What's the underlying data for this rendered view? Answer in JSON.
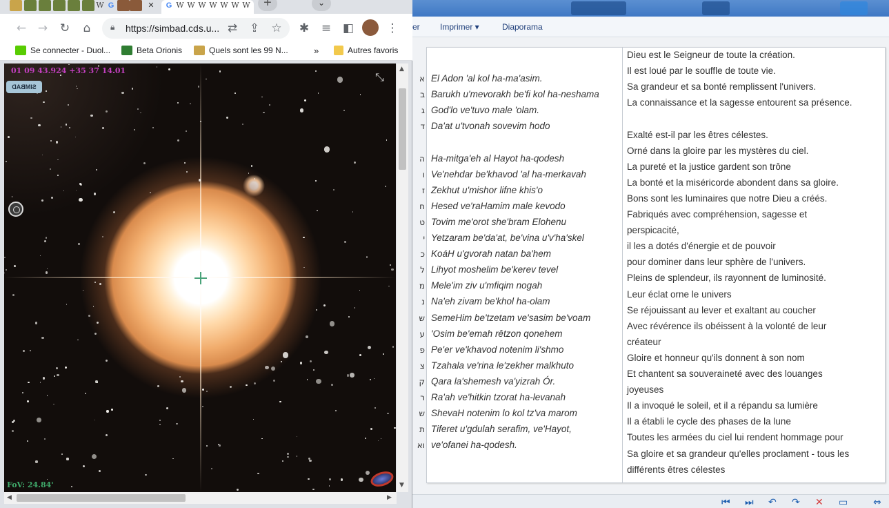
{
  "browser": {
    "active_tab_close": "✕",
    "new_tab": "+",
    "tab_search": "⌄",
    "url": "https://simbad.cds.u...",
    "bookmarks": [
      {
        "label": "Se connecter - Duol..."
      },
      {
        "label": "Beta Orionis"
      },
      {
        "label": "Quels sont les 99 N..."
      }
    ],
    "bookmarks_overflow": "»",
    "other_bookmarks": "Autres favoris"
  },
  "viewer": {
    "coords": "01 09 43.924 +35 37 14.01",
    "logo": "SIMBAD",
    "fov": "FoV: 24.84'"
  },
  "document": {
    "menu": [
      "er",
      "Imprimer ▾",
      "Diaporama"
    ],
    "hebrew": [
      "א",
      "ב",
      "ג",
      "ד",
      "ה",
      "ו",
      "ז",
      "ח",
      "ט",
      "י",
      "כ",
      "ל",
      "מ",
      "נ",
      "ש",
      "ע",
      "פ",
      "צ",
      "ק",
      "ר",
      "ש",
      "ת",
      "וא"
    ],
    "transliteration": [
      "El Adon 'al kol ha-ma'asim.",
      "Barukh u'mevorakh be'fi kol ha-neshama",
      "God'lo ve'tuvo male 'olam.",
      "Da'at u'tvonah sovevim hodo",
      "Ha-mitga'eh al Hayot ha-qodesh",
      "Ve'nehdar be'khavod 'al ha-merkavah",
      "Zekhut u'mishor lifne khis'o",
      "Hesed ve'raHamim male kevodo",
      "Tovim me'orot she'bram Elohenu",
      "Yetzaram be'da'at, be'vina u'v'ha'skel",
      "KoáH u'gvorah natan ba'hem",
      "Lihyot moshelim be'kerev tevel",
      "Mele'im ziv u'mfiqim nogah",
      "Na'eh zivam be'khol ha-olam",
      "SemeHim be'tzetam ve'sasim be'voam",
      "'Osim be'emah rêtzon qonehem",
      "Pe'er ve'khavod notenim li'shmo",
      "Tzahala ve'rina le'zekher malkhuto",
      "Qara la'shemesh va'yizrah Ór.",
      "Ra'ah ve'hitkin tzorat ha-levanah",
      "ShevaH notenim lo kol tz'va marom",
      "Tiferet u'gdulah serafim, ve'Hayot,",
      "ve'ofanei ha-qodesh."
    ],
    "french": [
      "Dieu est le Seigneur de toute la création.",
      "Il est loué par le souffle de toute vie.",
      "Sa grandeur et sa bonté remplissent l'univers.",
      "La connaissance et la sagesse entourent sa présence.",
      "Exalté est-il par les êtres célestes.",
      "Orné dans la gloire par les mystères du ciel.",
      "La pureté et la justice gardent son trône",
      "La bonté et la miséricorde abondent dans sa gloire.",
      "Bons sont les luminaires que notre Dieu a créés.",
      "Fabriqués avec compréhension, sagesse et",
      "perspicacité,",
      "il les a dotés d'énergie et de pouvoir",
      "pour dominer dans leur sphère de l'univers.",
      "Pleins de splendeur, ils rayonnent de luminosité.",
      "Leur éclat orne le univers",
      "Se réjouissant au lever et exaltant au coucher",
      "Avec révérence ils obéissent à la volonté de leur",
      "créateur",
      "Gloire et honneur qu'ils donnent à son nom",
      "Et chantent sa souveraineté avec des louanges",
      "joyeuses",
      "Il a invoqué le soleil, et il a répandu sa lumière",
      "Il a établi le cycle des phases de la lune",
      "Toutes les armées du ciel lui rendent hommage pour",
      "Sa gloire et sa grandeur qu'elles proclament - tous les",
      "différents êtres célestes"
    ]
  }
}
